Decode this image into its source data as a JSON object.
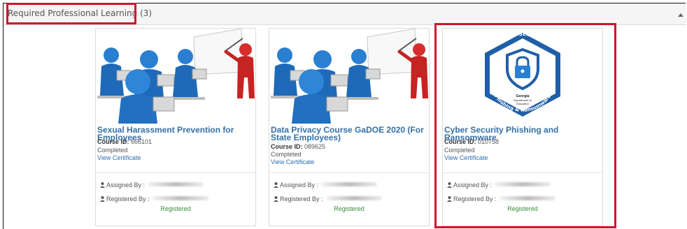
{
  "panel": {
    "title": "Required Professional Learning (3)"
  },
  "labels": {
    "course_id": "Course ID:",
    "assigned_by": "Assigned By :",
    "registered_by": "Registered By :"
  },
  "courses": [
    {
      "title": "Sexual Harassment Prevention for Employees",
      "course_id": "666101",
      "status": "Completed",
      "certificate_link": "View Certificate",
      "registration_status": "Registered",
      "image": "classroom-presentation-illustration"
    },
    {
      "title": "Data Privacy Course GaDOE 2020 (For State Employees)",
      "course_id": "089625",
      "status": "Completed",
      "certificate_link": "View Certificate",
      "registration_status": "Registered",
      "image": "classroom-presentation-illustration"
    },
    {
      "title": "Cyber Security Phishing and Ransomware",
      "course_id": "010758",
      "status": "Completed",
      "certificate_link": "View Certificate",
      "registration_status": "Registered",
      "image": "cyber-security-badge"
    }
  ],
  "badge": {
    "top_text": "CYBER SECURITY",
    "bottom_text": "Phishing & Ransomware",
    "org_line1": "Georgia",
    "org_line2": "Department of",
    "org_line3": "Education"
  },
  "colors": {
    "highlight": "#d3122c",
    "link": "#2d6eb3",
    "registered": "#3a8a3a",
    "badge_blue": "#1f5fa8"
  }
}
